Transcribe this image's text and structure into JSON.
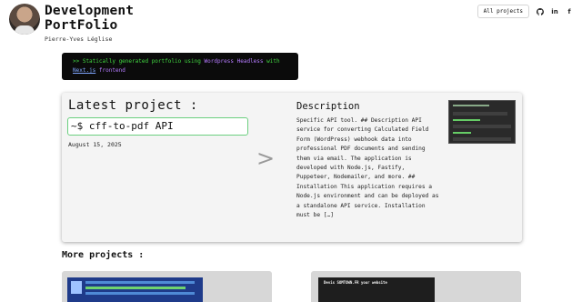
{
  "header": {
    "title_line1": "Development",
    "title_line2": "PortFolio",
    "author": "Pierre-Yves Léglise"
  },
  "nav": {
    "all_projects": "All projects",
    "icons": [
      "github-icon",
      "linkedin-icon",
      "facebook-icon"
    ]
  },
  "banner": {
    "prefix": ">> Statically generated portfolio using ",
    "wordpress": "Wordpress Headless",
    "with": " with",
    "nextjs": "Next.js",
    "frontend": " frontend"
  },
  "latest": {
    "heading": "Latest project :",
    "project": "~$ cff-to-pdf API",
    "date": "August 15, 2025",
    "arrow": ">",
    "description_heading": "Description",
    "description": "Specific API tool. ## Description API service for converting Calculated Field Form (WordPress) webhook data into professional PDF documents and sending them via email. The application is developed with Node.js, Fastify, Puppeteer, Nodemailer, and more. ## Installation This application requires a Node.js environment and can be deployed as a standalone API service. Installation must be […]"
  },
  "more": {
    "heading": "More projects :",
    "project2_title": "Devis SOMTOWN.FR your website"
  },
  "colors": {
    "accent_green": "#6bcf7f",
    "terminal_green": "#42d842",
    "terminal_purple": "#b57bff"
  }
}
